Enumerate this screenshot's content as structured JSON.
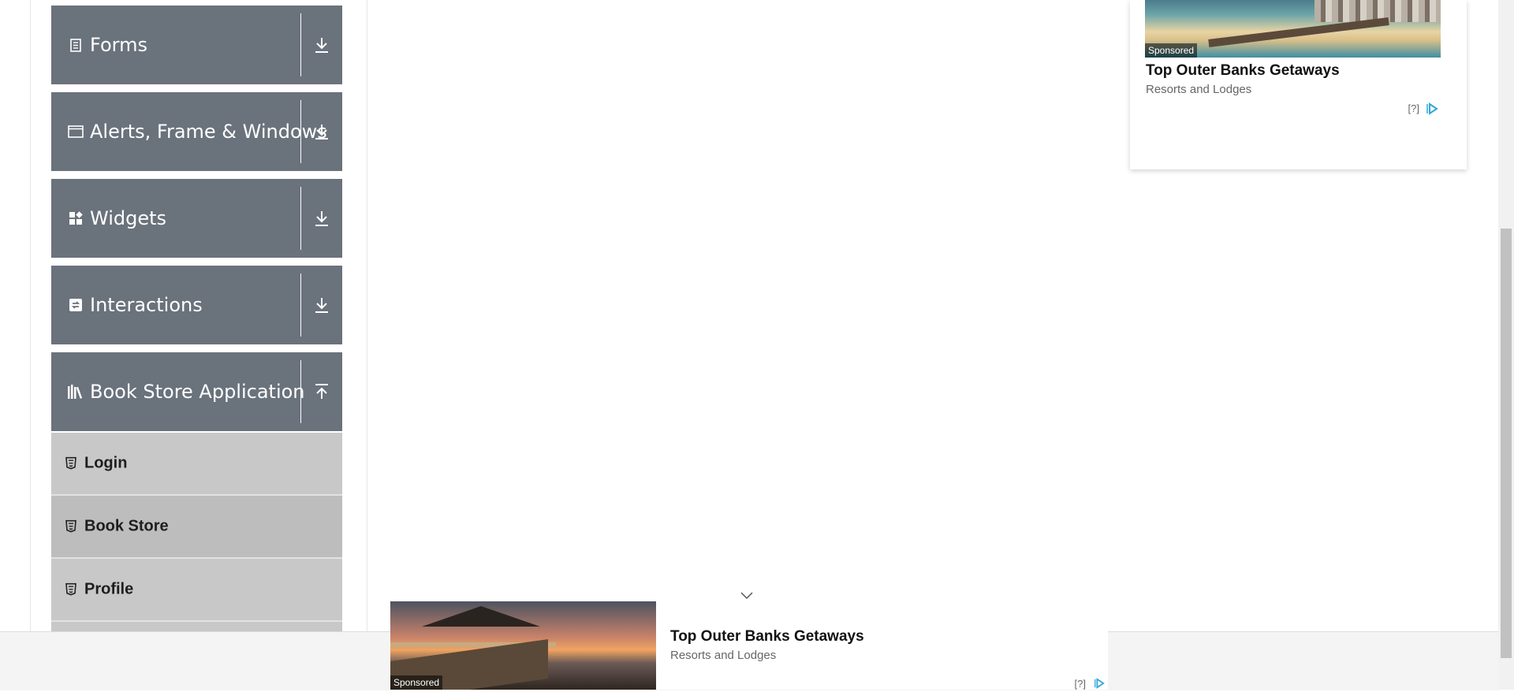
{
  "sidebar": {
    "groups": [
      {
        "label": "Forms",
        "icon": "form-icon",
        "expanded": false
      },
      {
        "label": "Alerts, Frame & Windows",
        "icon": "window-icon",
        "expanded": false
      },
      {
        "label": "Widgets",
        "icon": "widgets-icon",
        "expanded": false
      },
      {
        "label": "Interactions",
        "icon": "interactions-icon",
        "expanded": false
      },
      {
        "label": "Book Store Application",
        "icon": "books-icon",
        "expanded": true
      }
    ],
    "book_store_items": [
      {
        "label": "Login",
        "icon": "html5-icon"
      },
      {
        "label": "Book Store",
        "icon": "html5-icon",
        "active": true
      },
      {
        "label": "Profile",
        "icon": "html5-icon"
      }
    ]
  },
  "side_ad": {
    "sponsored": "Sponsored",
    "title": "Top Outer Banks Getaways",
    "subtitle": "Resorts and Lodges",
    "help": "[?]",
    "choice_icon": "adchoices-icon"
  },
  "bottom_ad": {
    "sponsored": "Sponsored",
    "title": "Top Outer Banks Getaways",
    "subtitle": "Resorts and Lodges",
    "help": "[?]",
    "collapse_icon": "chevron-down-icon"
  },
  "colors": {
    "group_bg": "#6a727c",
    "sub_item_bg": "#c8c8c8",
    "adchoice_blue": "#2ea6d8"
  }
}
